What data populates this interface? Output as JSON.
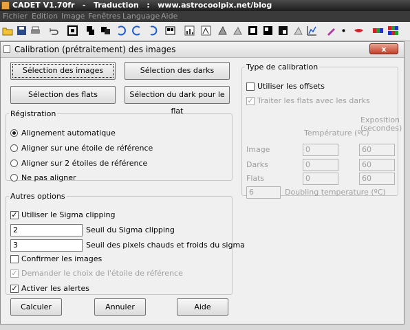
{
  "window": {
    "title": "CADET V1.70fr   -   Traduction   :   www.astrocoolpix.net/blog"
  },
  "menu": [
    "Fichier",
    "Edition",
    "Image",
    "Fenêtres",
    "Language",
    "Aide"
  ],
  "toolbar_icons": [
    "open-folder-icon",
    "save-icon",
    "print-icon",
    "undo-icon",
    "frame-icon",
    "stack-icon",
    "stack-dark-icon",
    "rotate-left-icon",
    "rotate-right-icon",
    "rotate-180-icon",
    "grid-icon",
    "histogram-icon",
    "tool-a-icon",
    "tool-b-icon",
    "tool-c-icon",
    "square-icon",
    "square-b-icon",
    "square-c-icon",
    "tool-d-icon",
    "chart-icon",
    "pen-icon",
    "dot-icon",
    "lips-icon",
    "rgb-icon",
    "rgb-grid-icon"
  ],
  "dialog": {
    "title": "Calibration (prétraitement) des images",
    "close": "x",
    "buttons": {
      "images": "Sélection des images",
      "darks": "Sélection des darks",
      "flats": "Sélection des flats",
      "dark_for_flat": "Sélection du dark pour le flat"
    },
    "registration": {
      "legend": "Régistration",
      "options": [
        "Alignement automatique",
        "Aligner sur une étoile de référence",
        "Aligner sur 2 étoiles de référence",
        "Ne pas aligner"
      ],
      "selected": 0
    },
    "other": {
      "legend": "Autres options",
      "sigma_clipping": "Utiliser le Sigma clipping",
      "sigma_threshold_value": "2",
      "sigma_threshold_label": "Seuil du Sigma clipping",
      "hot_cold_value": "3",
      "hot_cold_label": "Seuil des pixels chauds et froids du sigma",
      "confirm_images": "Confirmer les images",
      "ask_reference_star": "Demander le choix de l'étoile de référence",
      "enable_alerts": "Activer les alertes"
    },
    "calib_type": {
      "legend": "Type de calibration",
      "use_offsets": "Utiliser les offsets",
      "flats_with_darks": "Traiter les flats avec les darks",
      "temp_header": "Température (ºC)",
      "exposure_header_1": "Exposition",
      "exposure_header_2": "(secondes)",
      "rows": [
        {
          "label": "Image",
          "temp": "0",
          "exposure": "60"
        },
        {
          "label": "Darks",
          "temp": "0",
          "exposure": "60"
        },
        {
          "label": "Flats",
          "temp": "0",
          "exposure": "60"
        }
      ],
      "doubling_value": "6",
      "doubling_label": "Doubling temperature (ºC)"
    },
    "footer": {
      "compute": "Calculer",
      "cancel": "Annuler",
      "help": "Aide"
    }
  }
}
